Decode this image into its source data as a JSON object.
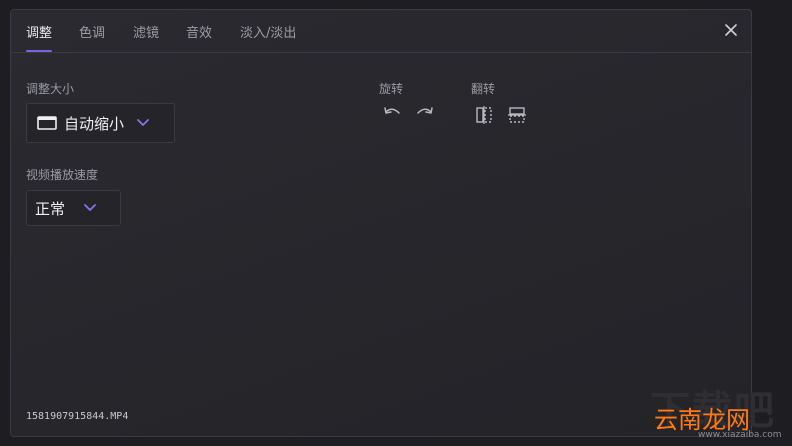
{
  "tabs": [
    {
      "label": "调整",
      "active": true
    },
    {
      "label": "色调",
      "active": false
    },
    {
      "label": "滤镜",
      "active": false
    },
    {
      "label": "音效",
      "active": false
    },
    {
      "label": "淡入/淡出",
      "active": false
    }
  ],
  "resize": {
    "label": "调整大小",
    "value": "自动缩小",
    "icon": "screen-icon"
  },
  "speed": {
    "label": "视频播放速度",
    "value": "正常"
  },
  "rotate": {
    "label": "旋转",
    "icons": [
      "rotate-left-icon",
      "rotate-right-icon"
    ]
  },
  "flip": {
    "label": "翻转",
    "icons": [
      "flip-horizontal-icon",
      "flip-vertical-icon"
    ]
  },
  "file": {
    "name": "1581907915844.MP4"
  },
  "watermark": {
    "big": "下载吧",
    "cn": "云南龙网",
    "url": "www.xiazaiba.com"
  },
  "colors": {
    "accent": "#7a62e0",
    "background": "#1d1d22",
    "panel": "#28282e",
    "watermark": "#ff7a12"
  }
}
